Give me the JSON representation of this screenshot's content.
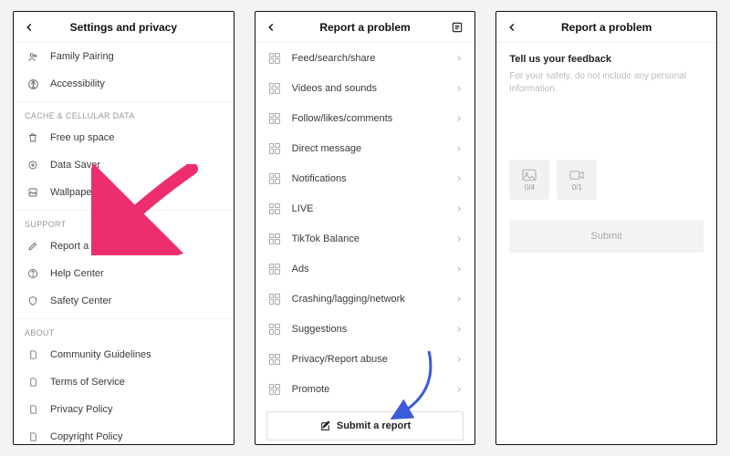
{
  "panel1": {
    "title": "Settings and privacy",
    "rows_top": [
      {
        "icon": "family-icon",
        "label": "Family Pairing"
      },
      {
        "icon": "accessibility-icon",
        "label": "Accessibility"
      }
    ],
    "sect_cache": "CACHE & CELLULAR DATA",
    "rows_cache": [
      {
        "icon": "trash-icon",
        "label": "Free up space"
      },
      {
        "icon": "datasaver-icon",
        "label": "Data Saver"
      },
      {
        "icon": "wallpaper-icon",
        "label": "Wallpaper"
      }
    ],
    "sect_support": "SUPPORT",
    "rows_support": [
      {
        "icon": "pencil-icon",
        "label": "Report a Problem"
      },
      {
        "icon": "help-icon",
        "label": "Help Center"
      },
      {
        "icon": "shield-icon",
        "label": "Safety Center"
      }
    ],
    "sect_about": "ABOUT",
    "rows_about": [
      {
        "icon": "doc-icon",
        "label": "Community Guidelines"
      },
      {
        "icon": "doc-icon",
        "label": "Terms of Service"
      },
      {
        "icon": "doc-icon",
        "label": "Privacy Policy"
      },
      {
        "icon": "doc-icon",
        "label": "Copyright Policy"
      }
    ]
  },
  "panel2": {
    "title": "Report a problem",
    "items": [
      "Feed/search/share",
      "Videos and sounds",
      "Follow/likes/comments",
      "Direct message",
      "Notifications",
      "LIVE",
      "TikTok Balance",
      "Ads",
      "Crashing/lagging/network",
      "Suggestions",
      "Privacy/Report abuse",
      "Promote"
    ],
    "submit": "Submit a report"
  },
  "panel3": {
    "title": "Report a problem",
    "feedback_label": "Tell us your feedback",
    "placeholder": "For your safety, do not include any personal information.",
    "attach_img": "0/4",
    "attach_vid": "0/1",
    "submit": "Submit"
  }
}
